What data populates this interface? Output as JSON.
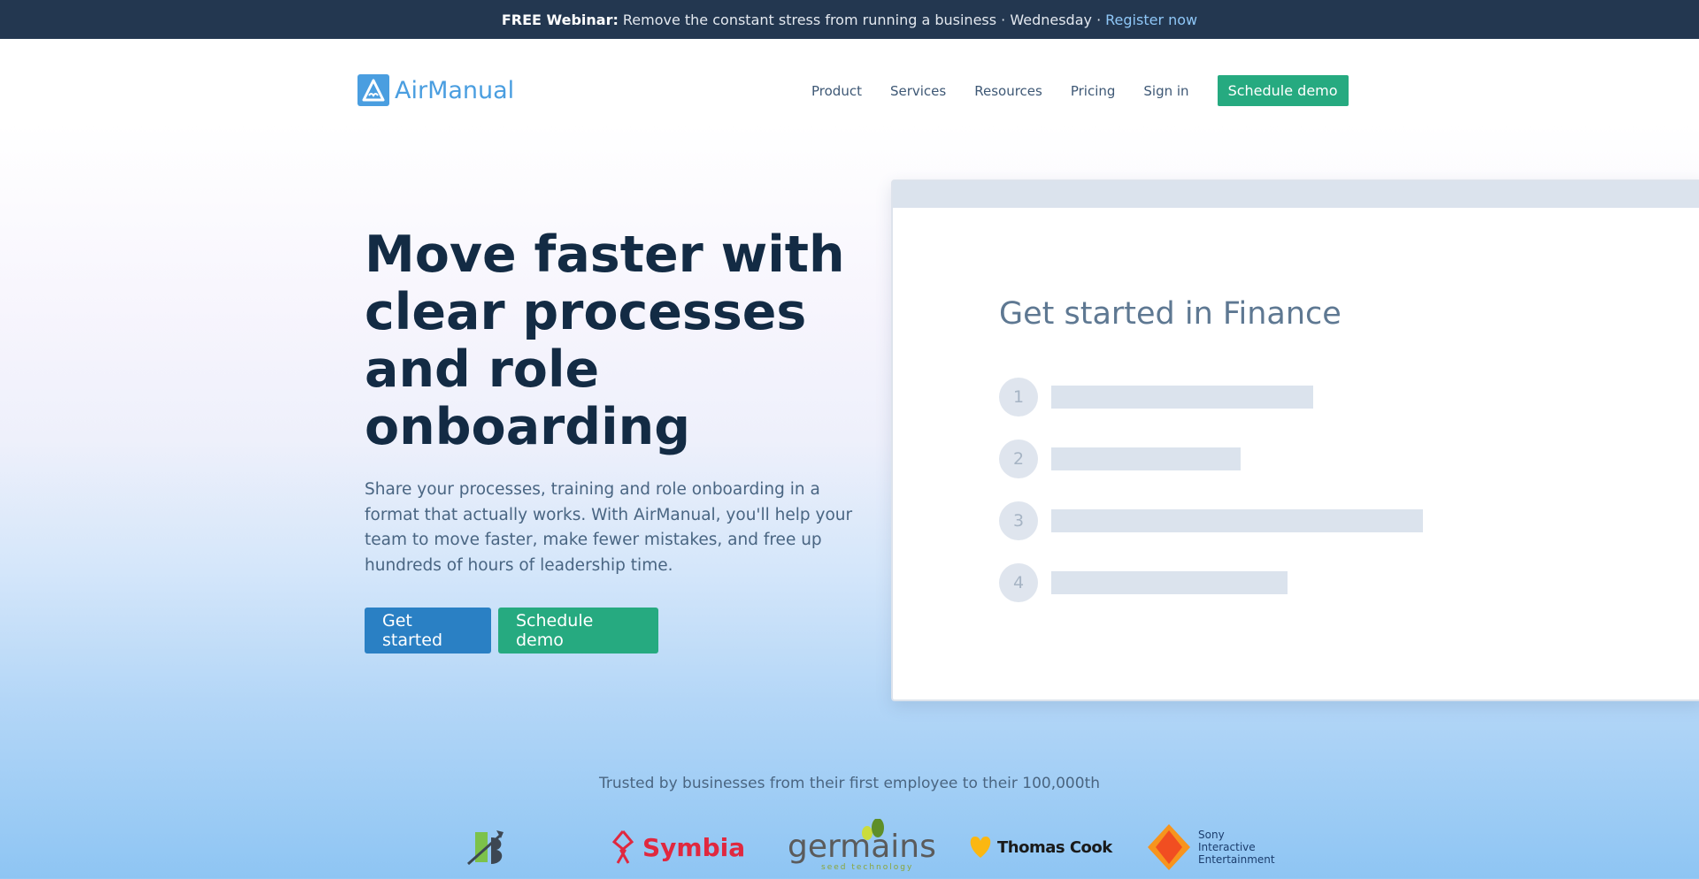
{
  "banner": {
    "strong": "FREE Webinar:",
    "text": "Remove the constant stress from running a business · Wednesday ·",
    "link": "Register now"
  },
  "brand": {
    "name": "AirManual",
    "color": "#4a9ee0"
  },
  "nav": {
    "items": [
      "Product",
      "Services",
      "Resources",
      "Pricing",
      "Sign in"
    ],
    "cta": "Schedule demo"
  },
  "hero": {
    "title": "Move faster with clear processes and role onboarding",
    "subtitle": "Share your processes, training and role onboarding in a format that actually works. With AirManual, you'll help your team to move faster, make fewer mistakes, and free up hundreds of hours of leadership time.",
    "primary": "Get started",
    "secondary": "Schedule demo"
  },
  "preview": {
    "title": "Get started in Finance",
    "steps": [
      "1",
      "2",
      "3",
      "4"
    ]
  },
  "trusted": {
    "text": "Trusted by businesses from their first employee to their 100,000th",
    "logos": [
      "DB",
      "Symbia",
      "germains",
      "seed technology",
      "Thomas Cook",
      "Sony",
      "Interactive",
      "Entertainment"
    ]
  },
  "colors": {
    "banner": "#233750",
    "primary": "#2a80c4",
    "accent": "#26aa80",
    "heading": "#132b44"
  }
}
